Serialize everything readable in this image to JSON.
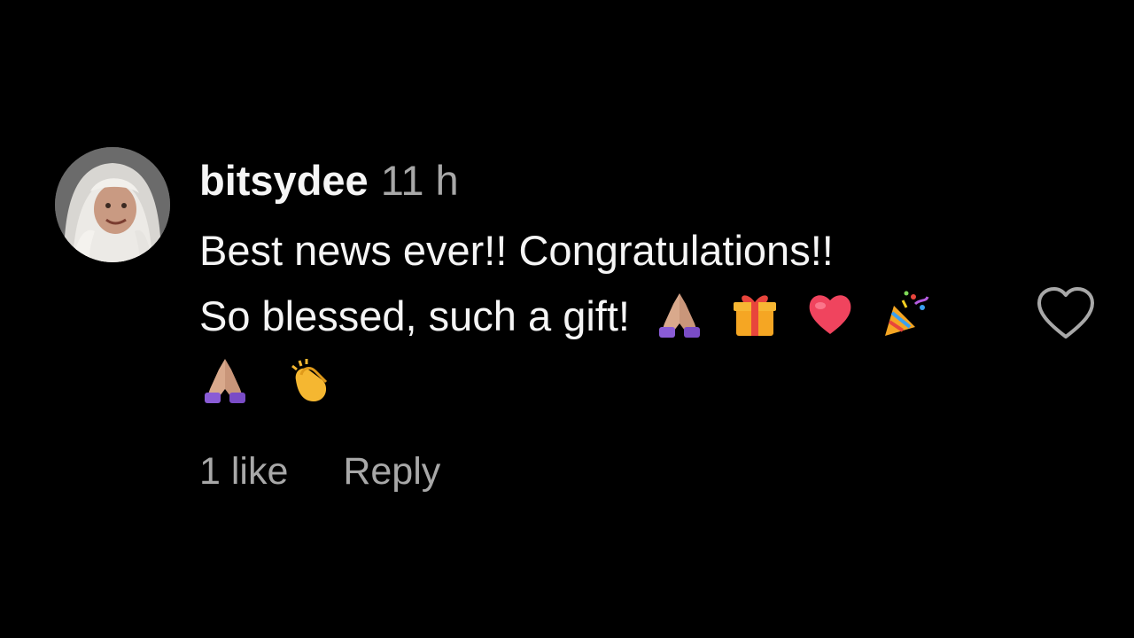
{
  "comment": {
    "username": "bitsydee",
    "timestamp": "11 h",
    "text_line_1": "Best news ever!! Congratulations!!",
    "text_line_2": "So blessed, such a gift!",
    "emoji_line_2": [
      "folded-hands",
      "wrapped-gift",
      "red-heart",
      "party-popper"
    ],
    "emoji_line_3": [
      "folded-hands",
      "clapping-hands"
    ],
    "likes_label": "1 like",
    "reply_label": "Reply",
    "like_icon": "heart-outline-icon",
    "avatar": "user-avatar"
  },
  "colors": {
    "background": "#000000",
    "primary_text": "#f5f5f5",
    "secondary_text": "#a8a8a8"
  }
}
